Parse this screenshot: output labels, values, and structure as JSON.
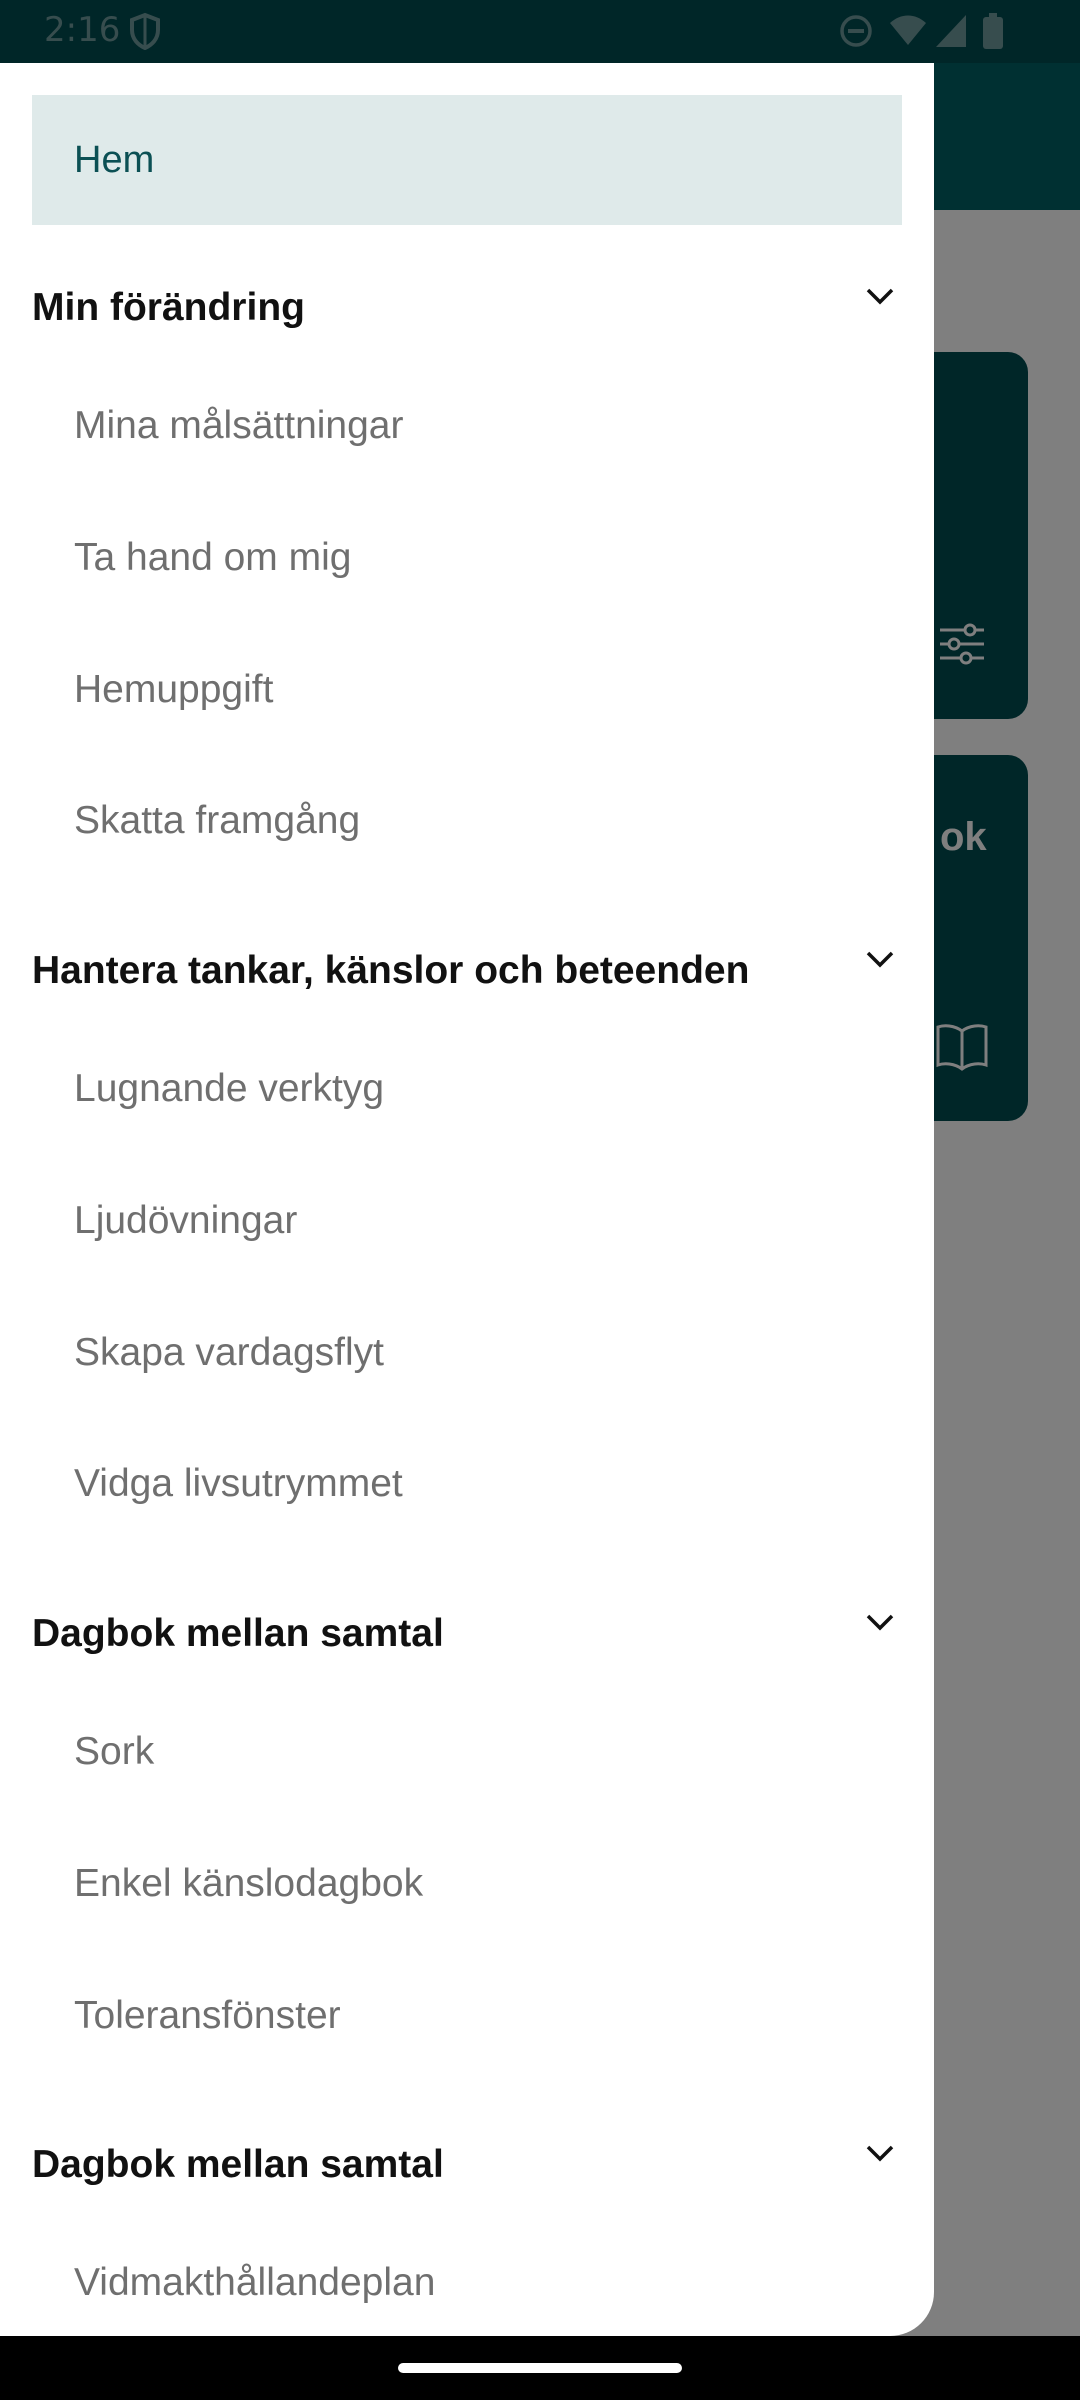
{
  "status_bar": {
    "time": "2:16",
    "icons": [
      "shield-icon",
      "do-not-disturb-icon",
      "wifi-icon",
      "signal-icon",
      "battery-icon"
    ]
  },
  "background": {
    "card2_title_fragment": "ok",
    "card1_icon": "sliders-icon",
    "card2_icon": "book-icon"
  },
  "drawer": {
    "home_label": "Hem",
    "sections": [
      {
        "title": "Min förändring",
        "items": [
          "Mina målsättningar",
          "Ta hand om mig",
          "Hemuppgift",
          "Skatta framgång"
        ]
      },
      {
        "title": "Hantera tankar, känslor och beteenden",
        "items": [
          "Lugnande verktyg",
          "Ljudövningar",
          "Skapa vardagsflyt",
          "Vidga livsutrymmet"
        ]
      },
      {
        "title": "Dagbok mellan samtal",
        "items": [
          "Sork",
          "Enkel känslodagbok",
          "Toleransfönster"
        ]
      },
      {
        "title": "Dagbok mellan samtal",
        "items": [
          "Vidmakthållandeplan"
        ]
      }
    ]
  },
  "colors": {
    "accent": "#006065",
    "accent_dark": "#004c50",
    "home_highlight": "#dfeaea",
    "sub_item_text": "#6f6f6f"
  }
}
